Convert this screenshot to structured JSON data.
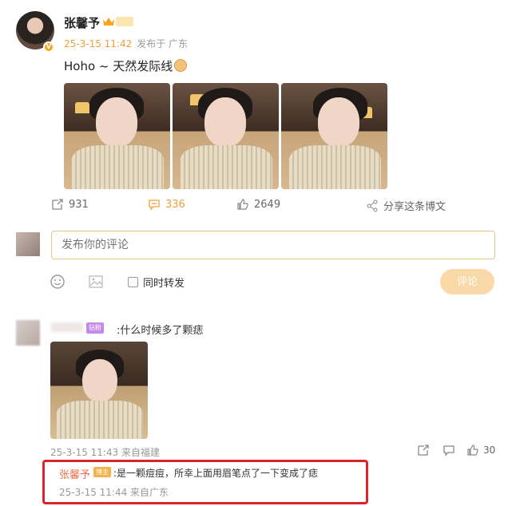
{
  "post": {
    "author": "张馨予",
    "time": "25-3-15 11:42",
    "location": "发布于 广东",
    "text": "Hoho ~ 天然发际线",
    "verified_icon": "v-badge-icon",
    "vip_icon": "crown-icon",
    "accent_color": "#f29e38"
  },
  "actions": {
    "repost_count": "931",
    "comment_count": "336",
    "like_count": "2649",
    "share_label": "分享这条博文"
  },
  "composer": {
    "placeholder": "发布你的评论",
    "repost_label": "同时转发",
    "submit_label": "评论"
  },
  "comments": [
    {
      "badge": "钻粉",
      "text": ":什么时候多了颗痣",
      "time_location": "25-3-15 11:43 来自福建",
      "likes": "30",
      "replies": [
        {
          "author": "张馨予",
          "badge": "博主",
          "text": ":是一颗痘痘，所幸上面用眉笔点了一下变成了痣",
          "time_location": "25-3-15 11:44 来自广东",
          "highlight_color": "#d9262a"
        }
      ]
    }
  ]
}
